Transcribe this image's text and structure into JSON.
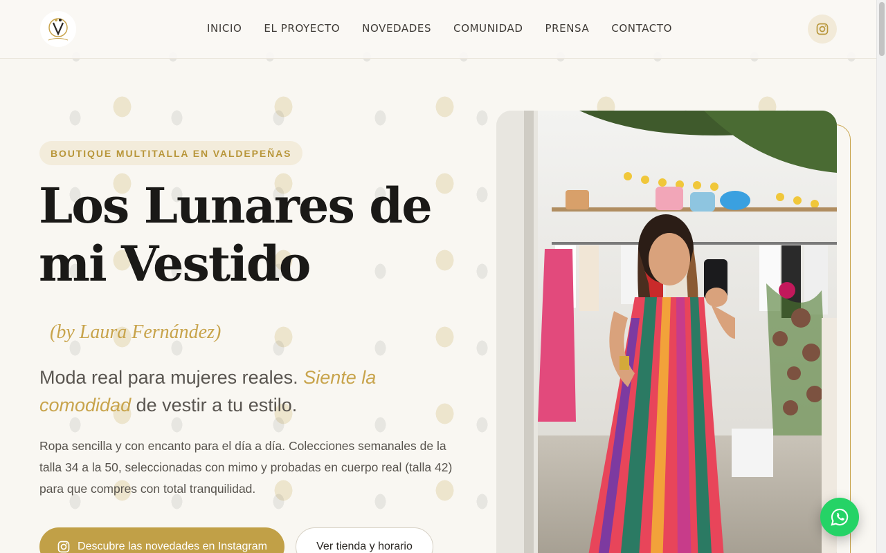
{
  "header": {
    "logo_icon": "lunares-logo-icon",
    "nav": [
      {
        "label": "INICIO"
      },
      {
        "label": "EL PROYECTO"
      },
      {
        "label": "NOVEDADES"
      },
      {
        "label": "COMUNIDAD"
      },
      {
        "label": "PRENSA"
      },
      {
        "label": "CONTACTO"
      }
    ],
    "instagram_icon": "instagram-icon"
  },
  "hero": {
    "badge": "BOUTIQUE MULTITALLA EN VALDEPEÑAS",
    "title": "Los Lunares de mi Vestido",
    "byline": "(by Laura Fernández)",
    "tagline_start": "Moda real para mujeres reales.",
    "tagline_accent": "Siente la comodidad",
    "tagline_end": "de vestir a tu estilo.",
    "description": "Ropa sencilla y con encanto para el día a día. Colecciones semanales de la talla 34 a la 50, seleccionadas con mimo y probadas en cuerpo real (talla 42) para que compres con total tranquilidad.",
    "primary_button": "Descubre las novedades en Instagram",
    "secondary_button": "Ver tienda y horario"
  },
  "floating": {
    "whatsapp_icon": "whatsapp-icon"
  },
  "colors": {
    "accent": "#c8a44c",
    "background": "#f9f7f2",
    "whatsapp": "#25d366"
  }
}
